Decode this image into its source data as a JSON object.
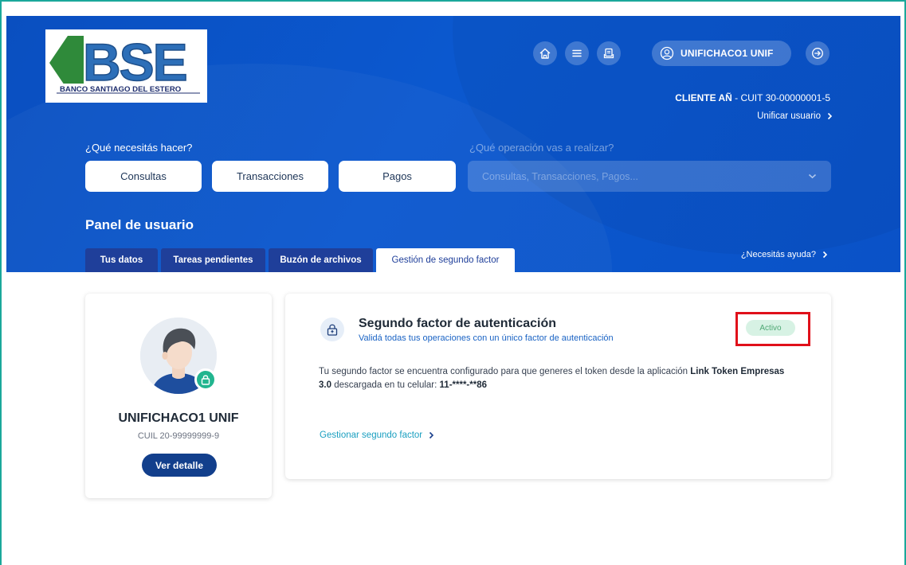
{
  "brand": {
    "logo_text": "BSE",
    "logo_subtitle": "BANCO SANTIAGO DEL ESTERO",
    "primary_color": "#0b55c9",
    "accent_green": "#1aa89a"
  },
  "topbar": {
    "icons": [
      "home-icon",
      "menu-icon",
      "document-icon"
    ],
    "user_name": "UNIFICHACO1 UNIF",
    "client_label": "CLIENTE AÑ",
    "client_cuit": " - CUIT 30-00000001-5",
    "unify_link": "Unificar usuario"
  },
  "quick": {
    "question": "¿Qué necesitás hacer?",
    "buttons": [
      "Consultas",
      "Transacciones",
      "Pagos"
    ],
    "operation_question": "¿Qué operación vas a realizar?",
    "operation_placeholder": "Consultas, Transacciones, Pagos..."
  },
  "panel": {
    "title": "Panel de usuario",
    "tabs": [
      {
        "label": "Tus datos"
      },
      {
        "label": "Tareas pendientes"
      },
      {
        "label": "Buzón de archivos"
      },
      {
        "label": "Gestión de segundo factor"
      }
    ],
    "active_tab": "Gestión de segundo factor",
    "help_link": "¿Necesitás ayuda?"
  },
  "profile": {
    "name": "UNIFICHACO1 UNIF",
    "cuil": "CUIL 20-99999999-9",
    "detail_button": "Ver detalle"
  },
  "second_factor": {
    "title": "Segundo factor de autenticación",
    "subtitle": "Validá todas tus operaciones con un único factor de autenticación",
    "status": "Activo",
    "desc_prefix": "Tu segundo factor se encuentra configurado para que generes el token desde la aplicación ",
    "app_name": "Link Token Empresas 3.0",
    "desc_middle": " descargada en tu celular: ",
    "phone": "11-****-**86",
    "manage_link": "Gestionar segundo factor"
  }
}
